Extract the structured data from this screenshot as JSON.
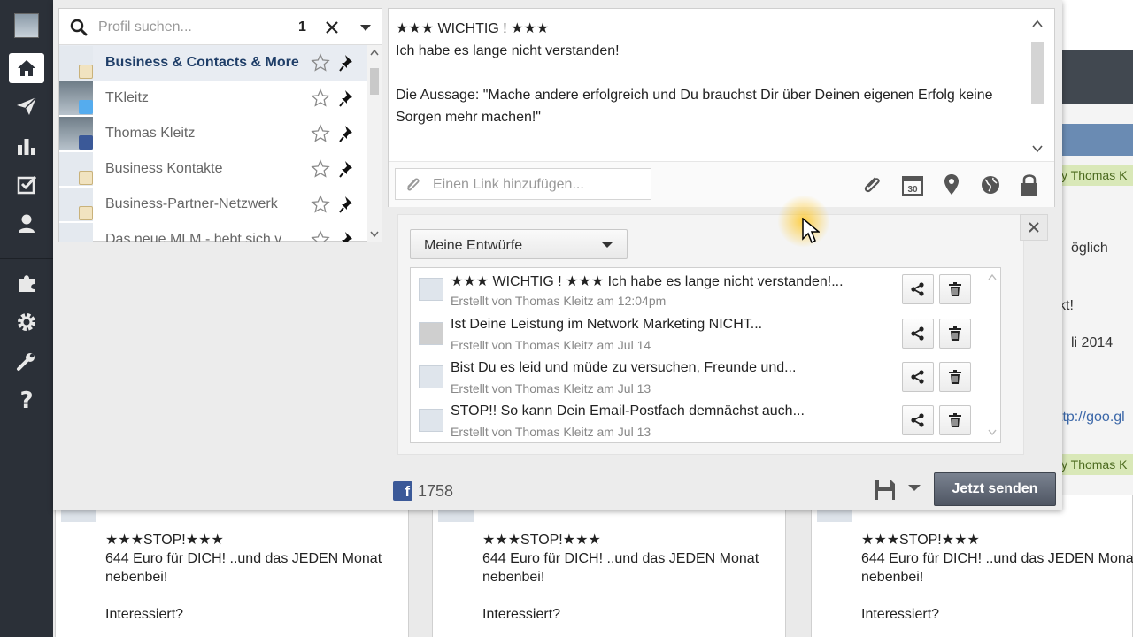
{
  "nav": {
    "items": [
      {
        "name": "home-icon",
        "active": true
      },
      {
        "name": "send-icon",
        "active": false
      },
      {
        "name": "analytics-icon",
        "active": false
      },
      {
        "name": "tasks-icon",
        "active": false
      },
      {
        "name": "contacts-icon",
        "active": false
      },
      {
        "name": "apps-icon",
        "active": false
      },
      {
        "name": "settings-icon",
        "active": false
      },
      {
        "name": "tools-icon",
        "active": false
      },
      {
        "name": "help-icon",
        "active": false
      }
    ]
  },
  "profile_search": {
    "placeholder": "Profil suchen...",
    "selected_count": "1"
  },
  "profiles": [
    {
      "label": "Business & Contacts & More",
      "selected": true,
      "network": "group"
    },
    {
      "label": "TKleitz",
      "selected": false,
      "network": "twitter"
    },
    {
      "label": "Thomas Kleitz",
      "selected": false,
      "network": "facebook"
    },
    {
      "label": "Business Kontakte",
      "selected": false,
      "network": "group"
    },
    {
      "label": "Business-Partner-Netzwerk",
      "selected": false,
      "network": "group"
    },
    {
      "label": "Das neue MLM - hebt sich v...",
      "selected": false,
      "network": "group"
    }
  ],
  "message": {
    "text": "★★★ WICHTIG ! ★★★\nIch habe es lange nicht verstanden!\n\nDie Aussage: \"Mache andere erfolgreich und Du brauchst Dir über Deinen eigenen Erfolg keine Sorgen mehr machen!\""
  },
  "link": {
    "placeholder": "Einen Link hinzufügen..."
  },
  "tools": {
    "calendar_day": "30"
  },
  "drafts": {
    "selector_label": "Meine Entwürfe",
    "items": [
      {
        "title": "★★★ WICHTIG ! ★★★ Ich habe es lange nicht verstanden!...",
        "meta": "Erstellt von Thomas Kleitz am 12:04pm"
      },
      {
        "title": "Ist Deine Leistung im Network Marketing NICHT...",
        "meta": "Erstellt von Thomas Kleitz am Jul 14"
      },
      {
        "title": "Bist Du es leid und müde zu versuchen, Freunde und...",
        "meta": "Erstellt von Thomas Kleitz am Jul 13"
      },
      {
        "title": "STOP!! So kann Dein Email-Postfach demnächst auch...",
        "meta": "Erstellt von Thomas Kleitz am Jul 13"
      }
    ]
  },
  "footer": {
    "fb_count": "1758",
    "send_label": "Jetzt senden"
  },
  "background": {
    "right_green_1": "y Thomas K",
    "right_green_2": "y Thomas K",
    "right_text_1": "öglich",
    "right_text_2": "kt!",
    "right_text_3": "li 2014",
    "right_link": "ttp://goo.gl",
    "col_post": "★★★STOP!★★★\n644 Euro für DICH! ..und das JEDEN Monat\nnebenbei!\n\nInteressiert?"
  },
  "colors": {
    "nav_bg": "#2b3038",
    "accent": "#1f3e68",
    "send_button": "#5a616e",
    "facebook": "#3b5998",
    "twitter": "#55acee"
  }
}
